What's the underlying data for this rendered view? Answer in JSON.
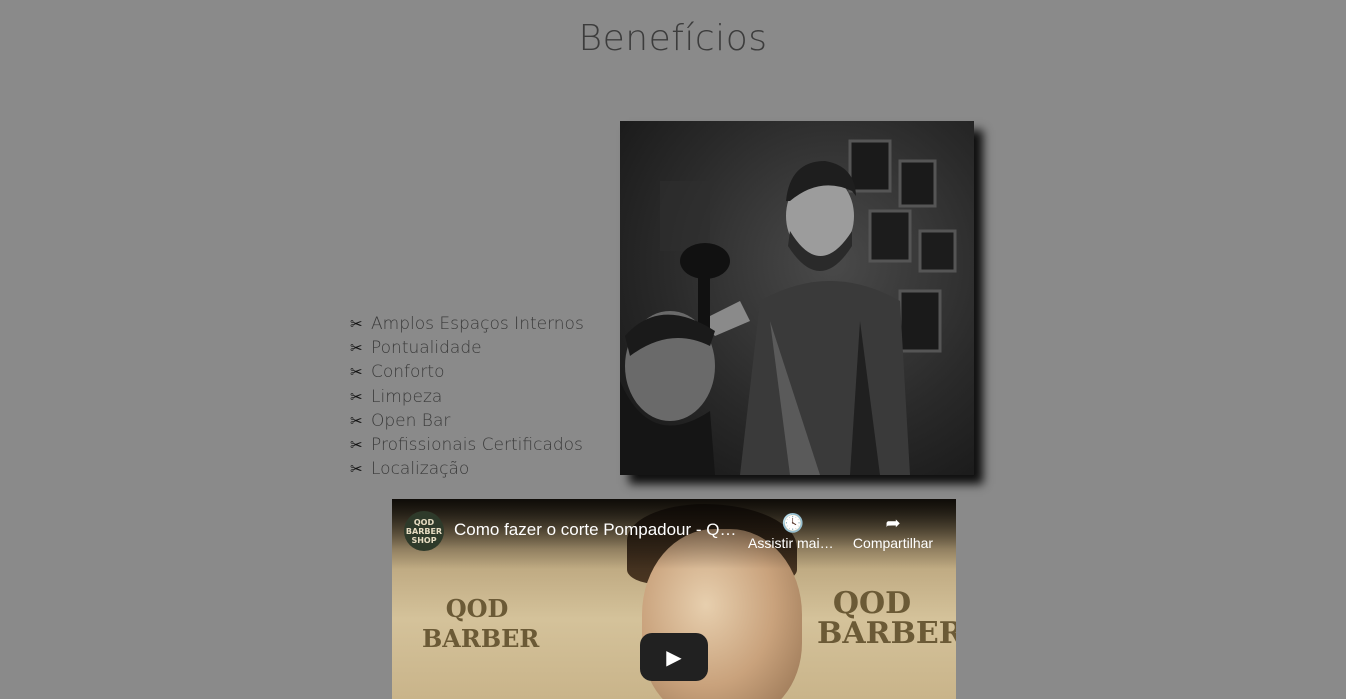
{
  "section": {
    "title": "Benefícios"
  },
  "benefits": {
    "icon": "scissors-icon",
    "items": [
      "Amplos Espaços Internos",
      "Pontualidade",
      "Conforto",
      "Limpeza",
      "Open Bar",
      "Profissionais Certificados",
      "Localização"
    ]
  },
  "photo": {
    "alt": "barber-photo"
  },
  "video": {
    "channel_logo_text": "QOD BARBER SHOP",
    "title": "Como fazer o corte Pompadour - QOD Barber Shop",
    "watch_later_label": "Assistir mais tarde",
    "share_label": "Compartilhar",
    "thumbnail_left_brand": "QOD BARBER",
    "thumbnail_right_brand": "QOD BARBER"
  }
}
